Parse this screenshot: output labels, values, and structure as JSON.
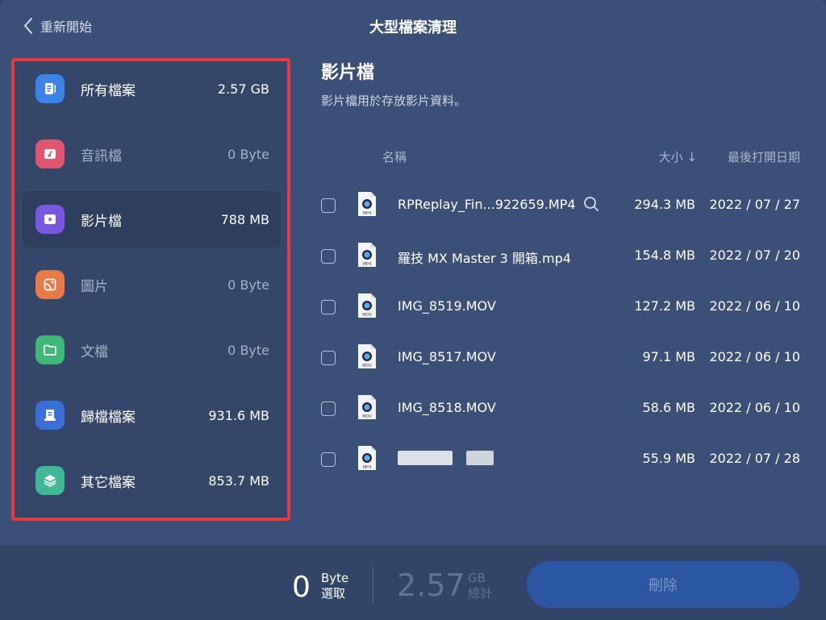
{
  "header": {
    "back_label": "重新開始",
    "title": "大型檔案清理"
  },
  "sidebar": {
    "items": [
      {
        "label": "所有檔案",
        "size": "2.57 GB",
        "icon": "document-icon",
        "color": "#3b83e6"
      },
      {
        "label": "音訊檔",
        "size": "0 Byte",
        "icon": "music-icon",
        "color": "#e0556f"
      },
      {
        "label": "影片檔",
        "size": "788 MB",
        "icon": "play-icon",
        "color": "#7a57e0"
      },
      {
        "label": "圖片",
        "size": "0 Byte",
        "icon": "image-icon",
        "color": "#e87a45"
      },
      {
        "label": "文檔",
        "size": "0 Byte",
        "icon": "folder-icon",
        "color": "#3fb777"
      },
      {
        "label": "歸檔檔案",
        "size": "931.6 MB",
        "icon": "archive-icon",
        "color": "#3a6fd8"
      },
      {
        "label": "其它檔案",
        "size": "853.7 MB",
        "icon": "layers-icon",
        "color": "#40b896"
      }
    ]
  },
  "main": {
    "title": "影片檔",
    "subtitle": "影片檔用於存放影片資料。",
    "columns": {
      "name": "名稱",
      "size": "大小 ↓",
      "date": "最後打開日期"
    },
    "files": [
      {
        "name": "RPReplay_Fin...922659.MP4",
        "size": "294.3 MB",
        "date": "2022 / 07 / 27",
        "icon_label": "MP4"
      },
      {
        "name": "羅技 MX Master 3 開箱.mp4",
        "size": "154.8 MB",
        "date": "2022 / 07 / 20",
        "icon_label": "MP4"
      },
      {
        "name": "IMG_8519.MOV",
        "size": "127.2 MB",
        "date": "2022 / 06 / 10",
        "icon_label": "MOV"
      },
      {
        "name": "IMG_8517.MOV",
        "size": "97.1 MB",
        "date": "2022 / 06 / 10",
        "icon_label": "MOV"
      },
      {
        "name": "IMG_8518.MOV",
        "size": "58.6 MB",
        "date": "2022 / 06 / 10",
        "icon_label": "MOV"
      },
      {
        "name": "",
        "size": "55.9 MB",
        "date": "2022 / 07 / 28",
        "icon_label": "MP4"
      }
    ]
  },
  "footer": {
    "selected_value": "0",
    "selected_unit": "Byte",
    "selected_label": "選取",
    "total_value": "2.57",
    "total_unit": "GB",
    "total_label": "總計",
    "delete_label": "刪除"
  },
  "colors": {
    "accent": "#2b57a2",
    "highlight_border": "#e63a3d"
  }
}
